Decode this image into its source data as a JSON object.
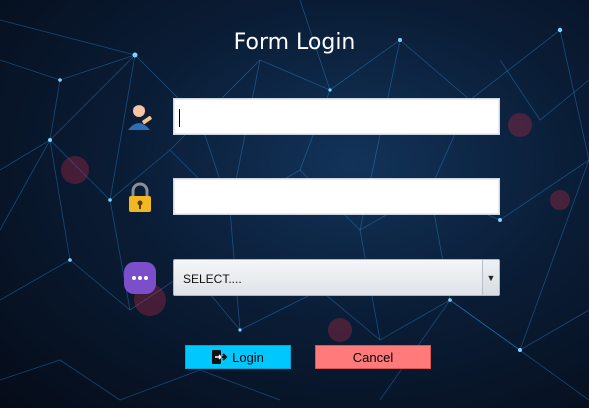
{
  "window": {
    "title": "Form Login"
  },
  "form": {
    "username": {
      "value": "",
      "icon": "user-icon"
    },
    "password": {
      "value": "",
      "icon": "lock-icon"
    },
    "role": {
      "selected": "SELECT....",
      "icon": "more-options-icon"
    }
  },
  "buttons": {
    "login_label": "Login",
    "login_icon": "sign-in-icon",
    "cancel_label": "Cancel"
  },
  "colors": {
    "login_button": "#00c8ff",
    "cancel_button": "#ff7b7b",
    "background": "#0a1d36"
  }
}
